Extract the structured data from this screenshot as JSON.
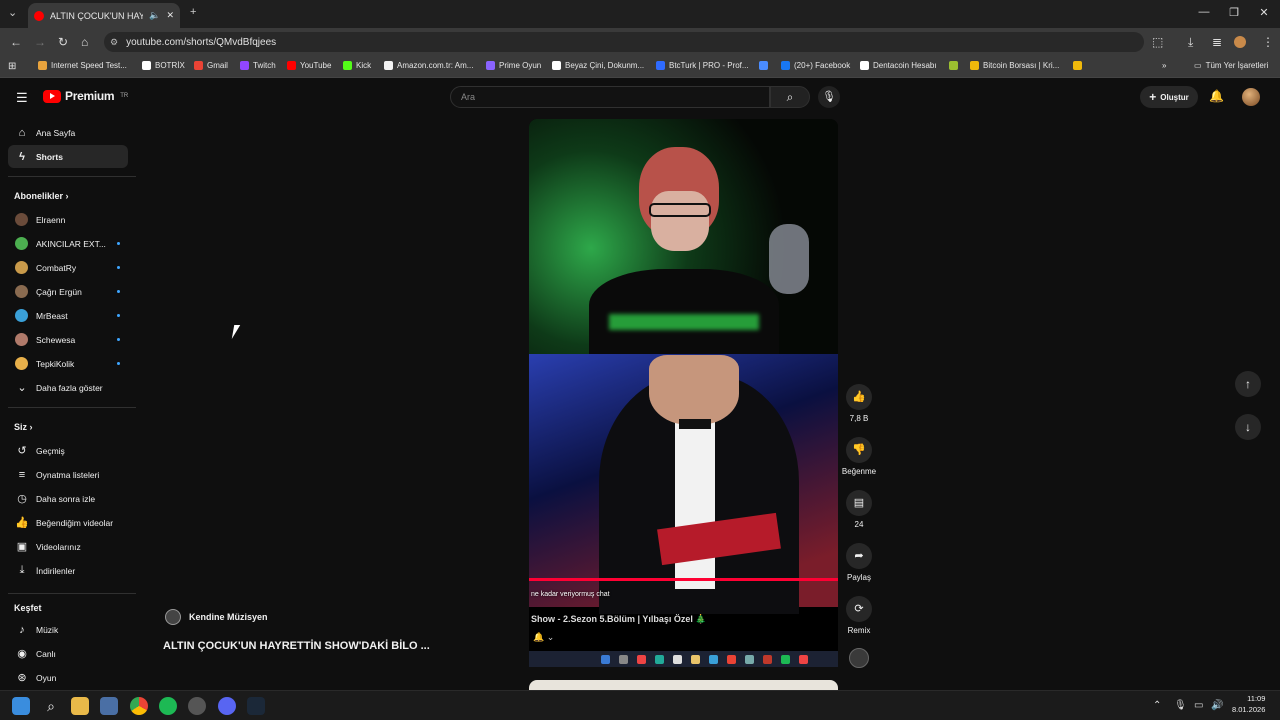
{
  "browser": {
    "tab_title": "ALTIN ÇOCUK'UN HAYRETTİ",
    "url": "youtube.com/shorts/QMvdBfqjees",
    "bookmarks": [
      {
        "label": "Internet Speed Test...",
        "color": "#e8a33d"
      },
      {
        "label": "BOTRİX",
        "color": "#ffffff"
      },
      {
        "label": "Gmail",
        "color": "#ea4335"
      },
      {
        "label": "Twitch",
        "color": "#9146ff"
      },
      {
        "label": "YouTube",
        "color": "#ff0000"
      },
      {
        "label": "Kick",
        "color": "#53fc18"
      },
      {
        "label": "Amazon.com.tr: Am...",
        "color": "#f3f3f3"
      },
      {
        "label": "Prime Oyun",
        "color": "#8a63ff"
      },
      {
        "label": "Beyaz Çini, Dokunm...",
        "color": "#ffffff"
      },
      {
        "label": "BtcTurk | PRO - Prof...",
        "color": "#2f6bff"
      },
      {
        "label": "",
        "color": "#4a8cff"
      },
      {
        "label": "(20+) Facebook",
        "color": "#1877f2"
      },
      {
        "label": "Dentacoin Hesabı",
        "color": "#ffffff"
      },
      {
        "label": "",
        "color": "#9bbf30"
      },
      {
        "label": "Bitcoin Borsası | Kri...",
        "color": "#f0b90b"
      },
      {
        "label": "",
        "color": "#f0b90b"
      }
    ],
    "all_bookmarks": "Tüm Yer İşaretleri"
  },
  "header": {
    "logo_text": "Premium",
    "country": "TR",
    "search_placeholder": "Ara",
    "create_label": "Oluştur"
  },
  "sidebar": {
    "main": [
      {
        "label": "Ana Sayfa",
        "icon": "home-icon",
        "glyph": "⌂"
      },
      {
        "label": "Shorts",
        "icon": "shorts-icon",
        "glyph": "ϟ"
      }
    ],
    "subs_title": "Abonelikler",
    "subs": [
      {
        "label": "Elraenn",
        "color": "#6a4b3a"
      },
      {
        "label": "AKINCILAR EXT...",
        "color": "#4caf50"
      },
      {
        "label": "CombatRy",
        "color": "#c99a4a"
      },
      {
        "label": "Çağrı Ergün",
        "color": "#8a6b50"
      },
      {
        "label": "MrBeast",
        "color": "#3aa0d8"
      },
      {
        "label": "Schewesa",
        "color": "#b07a6a"
      },
      {
        "label": "TepkiKolik",
        "color": "#e8b04a"
      }
    ],
    "show_more": "Daha fazla göster",
    "you_title": "Siz",
    "you": [
      {
        "label": "Geçmiş",
        "glyph": "↺"
      },
      {
        "label": "Oynatma listeleri",
        "glyph": "≡"
      },
      {
        "label": "Daha sonra izle",
        "glyph": "◷"
      },
      {
        "label": "Beğendiğim videolar",
        "glyph": "👍"
      },
      {
        "label": "Videolarınız",
        "glyph": "▣"
      },
      {
        "label": "İndirilenler",
        "glyph": "⤓"
      }
    ],
    "explore_title": "Keşfet",
    "explore": [
      {
        "label": "Müzik",
        "glyph": "♪"
      },
      {
        "label": "Canlı",
        "glyph": "◉"
      },
      {
        "label": "Oyun",
        "glyph": "⊛"
      }
    ]
  },
  "short": {
    "channel": "Kendine Müzisyen",
    "title": "ALTIN ÇOCUK'UN HAYRETTİN SHOW'DAKİ BİLO ...",
    "caption": "ne kadar veriyormuş chat",
    "video_title": "Show - 2.Sezon 5.Bölüm | Yılbaşı Özel 🎄",
    "likes": "7,8 B",
    "dislike_label": "Beğenme",
    "comments": "24",
    "share_label": "Paylaş",
    "remix_label": "Remix"
  },
  "clock": {
    "time": "11:09",
    "date": "8.01.2026"
  }
}
